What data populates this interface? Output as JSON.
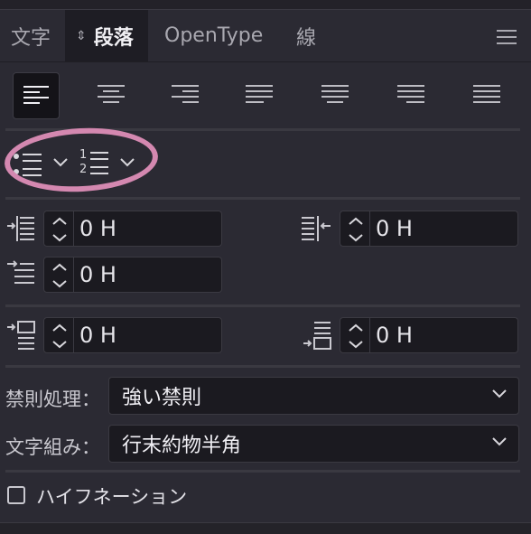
{
  "tabs": [
    {
      "label": "文字",
      "active": false
    },
    {
      "label": "段落",
      "active": true
    },
    {
      "label": "OpenType",
      "active": false
    },
    {
      "label": "線",
      "active": false
    }
  ],
  "tab_active_indicator": "⇕",
  "alignment_buttons": [
    "align-left-icon",
    "align-center-icon",
    "align-right-icon",
    "justify-left-icon",
    "justify-center-icon",
    "justify-right-icon",
    "justify-all-icon"
  ],
  "selected_alignment": "align-left",
  "list_controls": {
    "bullet_icon": "bullet-list-icon",
    "numbered_icon": "numbered-list-icon",
    "numbered_glyphs": [
      "1",
      "2"
    ],
    "annotation_color": "#d488b0"
  },
  "indents": {
    "left_indent": "0 H",
    "right_indent": "0 H",
    "first_line_indent": "0 H"
  },
  "spacing": {
    "space_before": "0 H",
    "space_after": "0 H"
  },
  "kinsoku": {
    "label": "禁則処理：",
    "value": "強い禁則"
  },
  "mojikumi": {
    "label": "文字組み：",
    "value": "行末約物半角"
  },
  "hyphenation": {
    "label": "ハイフネーション",
    "checked": false
  },
  "colors": {
    "panel_bg": "#2b2a33",
    "field_bg": "#1b1a20",
    "annotation": "#d488b0"
  }
}
